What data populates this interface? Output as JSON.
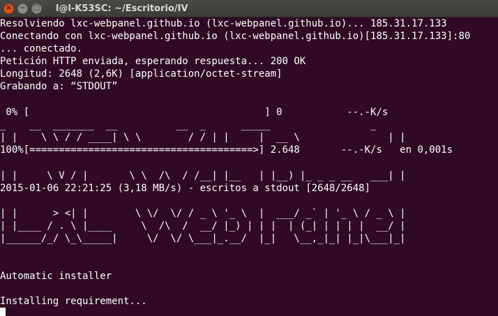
{
  "window": {
    "title": "l@l-K53SC: ~/Escritorio/IV",
    "controls": {
      "close": "×",
      "minimize": "−",
      "maximize": "□"
    }
  },
  "terminal": {
    "lines": [
      "Resolviendo lxc-webpanel.github.io (lxc-webpanel.github.io)... 185.31.17.133",
      "Conectando con lxc-webpanel.github.io (lxc-webpanel.github.io)[185.31.17.133]:80",
      "... conectado.",
      "Petición HTTP enviada, esperando respuesta... 200 OK",
      "Longitud: 2648 (2,6K) [application/octet-stream]",
      "Grabando a: “STDOUT”",
      " 0% [                                        ] 0           --.-K/s",
      "_    __  _______  __          __  _      _____                 _",
      "| |    \\ \\ / / ____| \\ \\        / / | |     |  __ \\               | |",
      "100%[======================================>] 2.648       --.-K/s   en 0,001s",
      "| |     \\ V / |       \\ \\  /\\  / /__| |__   | |__) |_ _ _ __   ___| |",
      "2015-01-06 22:21:25 (3,18 MB/s) - escritos a stdout [2648/2648]",
      "| |      > <| |        \\ \\/  \\/ / _ \\ '_ \\  |  ___/ _` | '_ \\ / _ \\ |",
      "| |____ / . \\ |____     \\  /\\  /  __/ |_) | | |  | (_| | | | |  __/ |",
      "|______/_/ \\_\\_____|     \\/  \\/ \\___|_.__/  |_|   \\__,_|_| |_|\\___|_|",
      "Automatic installer",
      "Installing requirement..."
    ]
  }
}
